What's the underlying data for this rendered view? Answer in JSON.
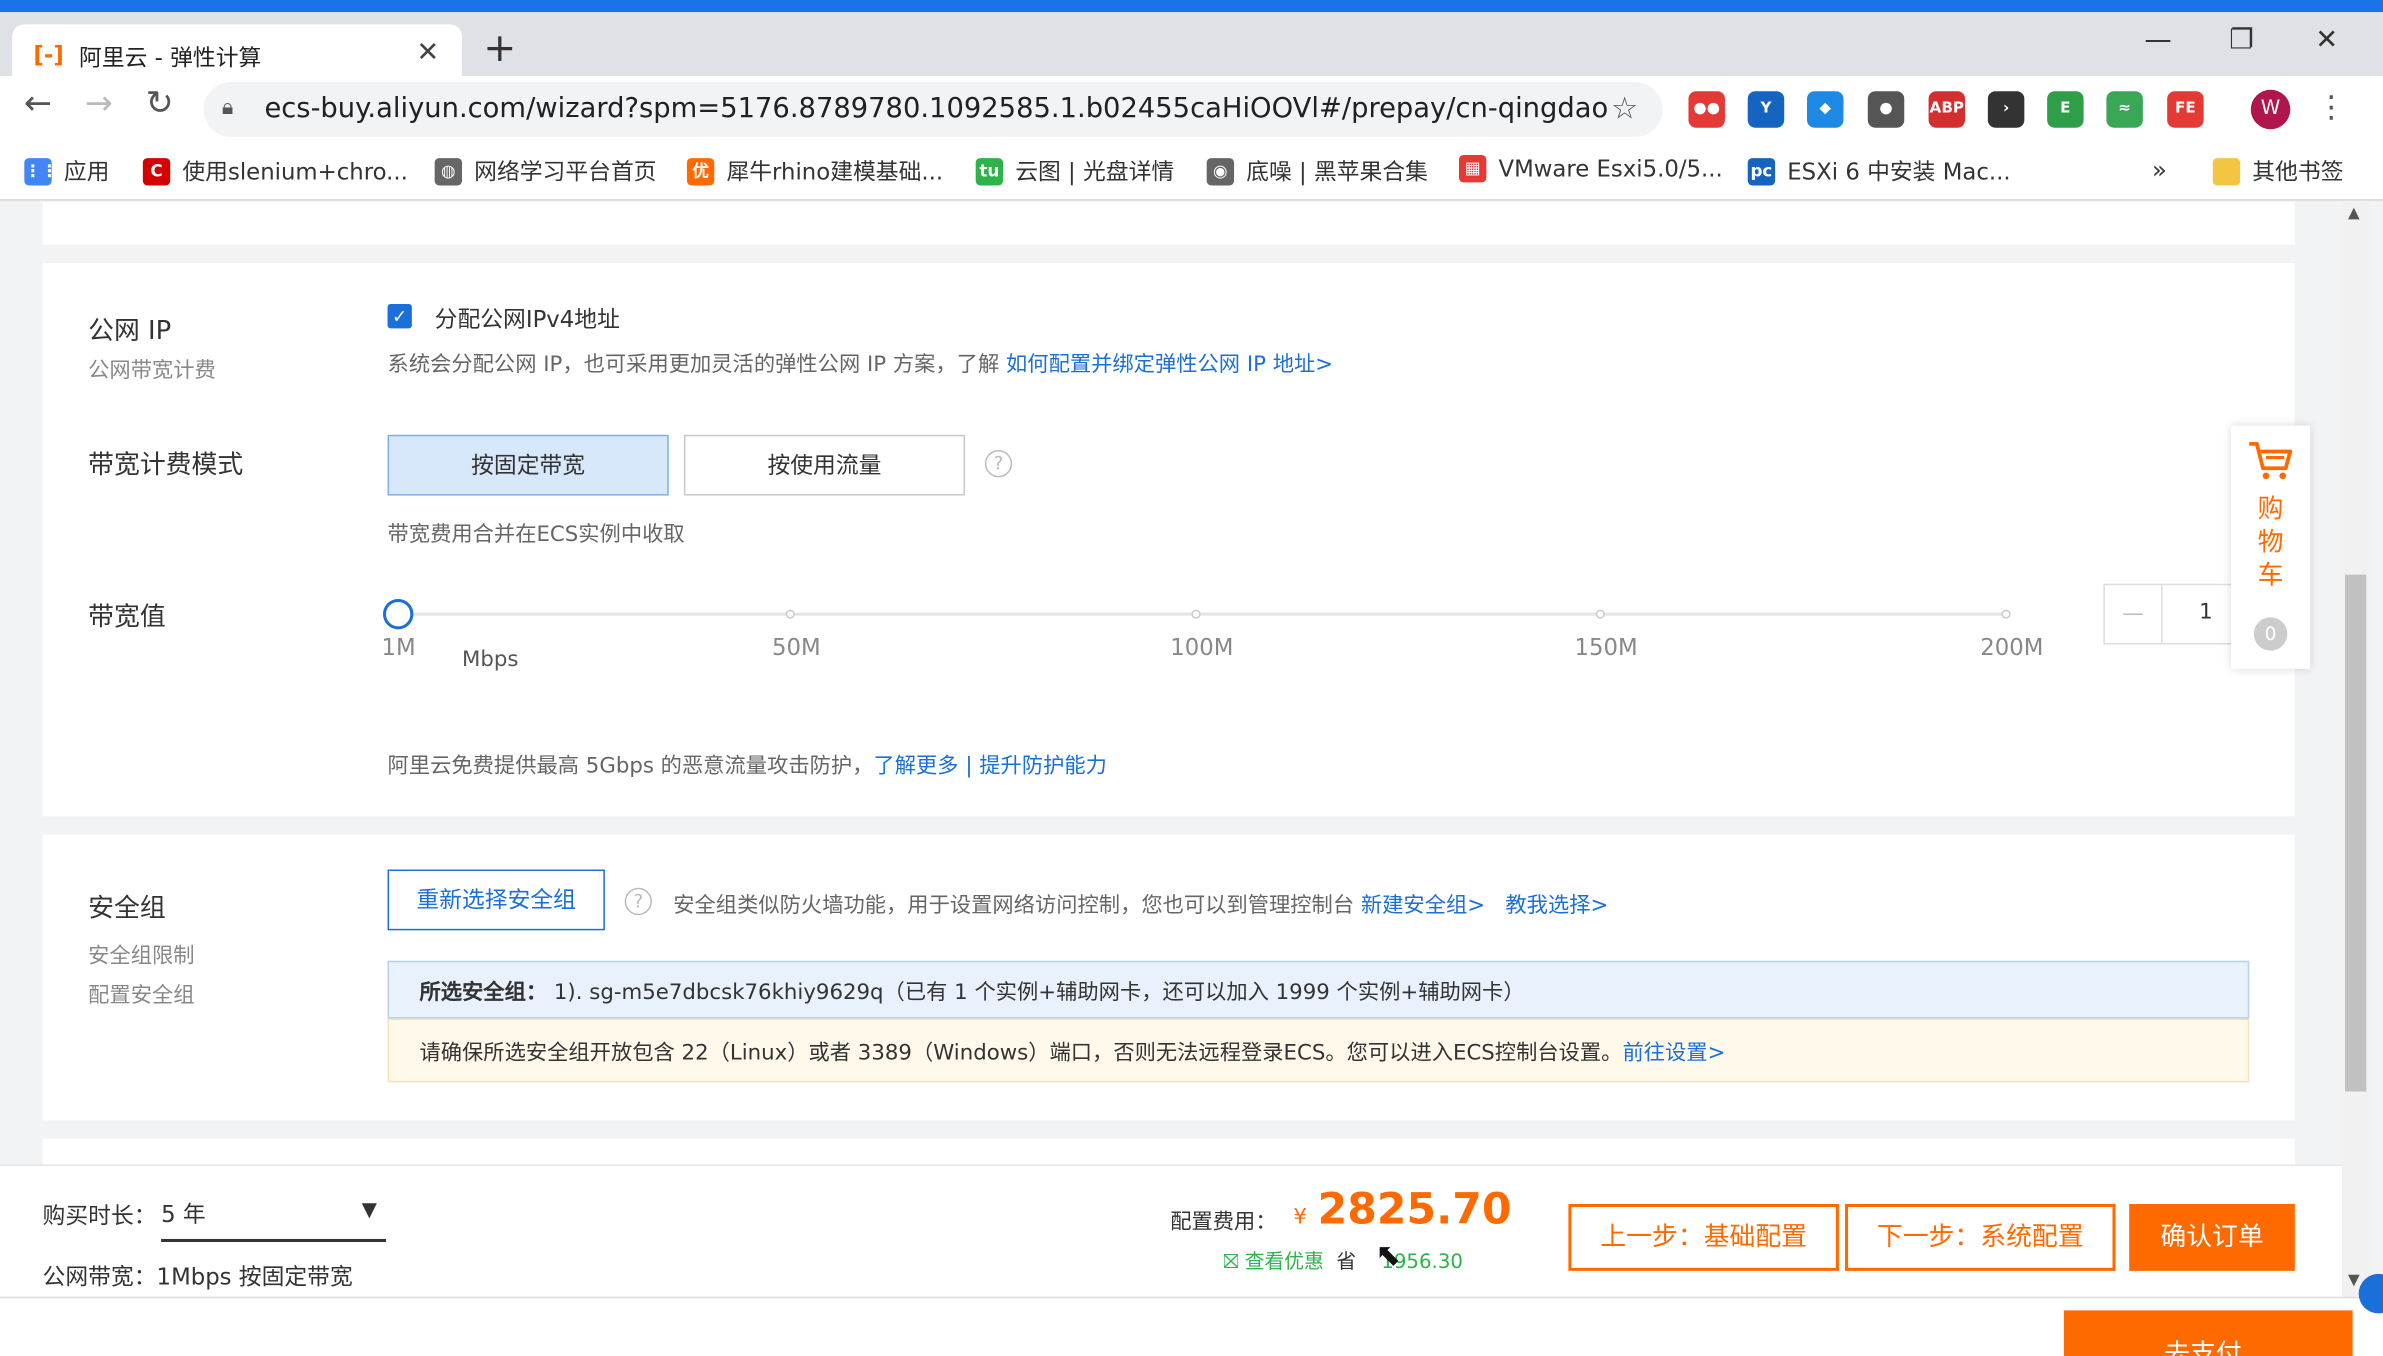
{
  "browser": {
    "tab_title": "阿里云 - 弹性计算",
    "tab_favicon": "[-]",
    "new_tab": "+",
    "url": "ecs-buy.aliyun.com/wizard?spm=5176.8789780.1092585.1.b02455caHiOOVl#/prepay/cn-qingdao",
    "avatar_letter": "W",
    "window_controls": [
      "—",
      "❐",
      "✕"
    ],
    "extensions": [
      {
        "name": "extension-red-icon",
        "color": "#e53935",
        "glyph": "●●"
      },
      {
        "name": "extension-y-icon",
        "color": "#1565c0",
        "glyph": "Y"
      },
      {
        "name": "extension-blue-icon",
        "color": "#1e88e5",
        "glyph": "◆"
      },
      {
        "name": "extension-balls-icon",
        "color": "#555555",
        "glyph": "●"
      },
      {
        "name": "adblock-icon",
        "color": "#d32f2f",
        "glyph": "ABP"
      },
      {
        "name": "extension-dark-icon",
        "color": "#333333",
        "glyph": "›"
      },
      {
        "name": "evernote-icon",
        "color": "#2e9e48",
        "glyph": "E"
      },
      {
        "name": "extension-green-icon",
        "color": "#3aa757",
        "glyph": "≈"
      },
      {
        "name": "fe-icon",
        "color": "#e53935",
        "glyph": "FE"
      }
    ]
  },
  "bookmarks": {
    "items": [
      {
        "label": "应用",
        "icon": "apps-grid-icon",
        "color": "#4285f4",
        "glyph": "⋮⋮"
      },
      {
        "label": "使用slenium+chro...",
        "icon": "c-logo-icon",
        "color": "#d50000",
        "glyph": "C"
      },
      {
        "label": "网络学习平台首页",
        "icon": "globe-icon",
        "color": "#666666",
        "glyph": "◍"
      },
      {
        "label": "犀牛rhino建模基础...",
        "icon": "youku-icon",
        "color": "#ff6a00",
        "glyph": "优"
      },
      {
        "label": "云图 | 光盘详情",
        "icon": "tu-icon",
        "color": "#2db34a",
        "glyph": "tu"
      },
      {
        "label": "底噪 | 黑苹果合集",
        "icon": "disc-icon",
        "color": "#666666",
        "glyph": "◉"
      },
      {
        "label": "VMware Esxi5.0/5...",
        "icon": "vmware-icon",
        "color": "#e53935",
        "glyph": "▦"
      },
      {
        "label": "ESXi 6 中安装 Mac...",
        "icon": "pc-icon",
        "color": "#1565c0",
        "glyph": "pc"
      }
    ],
    "overflow": "»",
    "other": "其他书签"
  },
  "public_ip": {
    "label": "公网 IP",
    "sublabel": "公网带宽计费",
    "checkbox_label": "分配公网IPv4地址",
    "checked": true,
    "desc": "系统会分配公网 IP，也可采用更加灵活的弹性公网 IP 方案，了解 ",
    "desc_link": "如何配置并绑定弹性公网 IP 地址>"
  },
  "billing_mode": {
    "label": "带宽计费模式",
    "options": [
      "按固定带宽",
      "按使用流量"
    ],
    "selected": "按固定带宽",
    "note": "带宽费用合并在ECS实例中收取"
  },
  "bandwidth": {
    "label": "带宽值",
    "ticks": [
      "1M",
      "50M",
      "100M",
      "150M",
      "200M"
    ],
    "unit": "Mbps",
    "value": "1",
    "minus": "—",
    "protect_text": "阿里云免费提供最高 5Gbps 的恶意流量攻击防护，",
    "link_more": "了解更多",
    "separator": " | ",
    "link_upgrade": "提升防护能力"
  },
  "security_group": {
    "label": "安全组",
    "sublabel1": "安全组限制",
    "sublabel2": "配置安全组",
    "reselect_button": "重新选择安全组",
    "desc": "安全组类似防火墙功能，用于设置网络访问控制，您也可以到管理控制台 ",
    "link_new": "新建安全组>",
    "link_teach": "教我选择>",
    "selected_label": "所选安全组：",
    "selected_value": "1). sg-m5e7dbcsk76khiy9629q（已有 1 个实例+辅助网卡，还可以加入 1999 个实例+辅助网卡）",
    "warning": "请确保所选安全组开放包含 22（Linux）或者 3389（Windows）端口，否则无法远程登录ECS。您可以进入ECS控制台设置。",
    "warning_link": "前往设置>"
  },
  "cart": {
    "label": "购物车",
    "count": "0"
  },
  "footer": {
    "duration_label": "购买时长：",
    "duration_value": "5 年",
    "bandwidth_summary_label": "公网带宽：",
    "bandwidth_summary_value": "1Mbps 按固定带宽",
    "fee_label": "配置费用：",
    "currency": "¥",
    "price": "2825.70",
    "discount_link": "查看优惠",
    "save_label": "省",
    "save_value": "1956.30",
    "prev_button": "上一步：基础配置",
    "next_button": "下一步：系统配置",
    "confirm_button": "确认订单"
  },
  "taskbar": {
    "partial_button": "去支付"
  }
}
